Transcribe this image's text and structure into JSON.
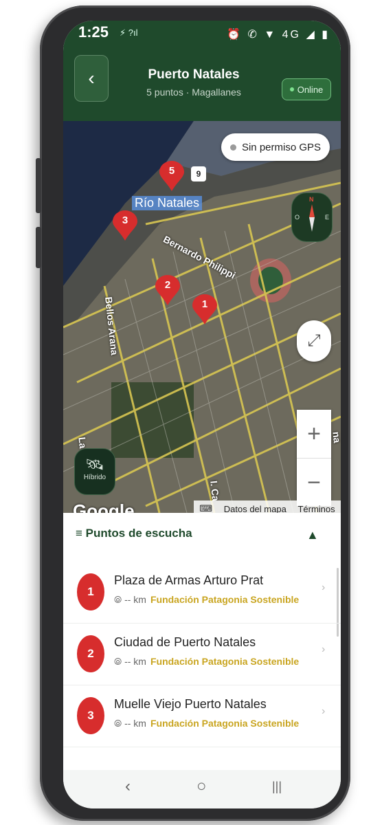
{
  "status": {
    "time": "1:25",
    "left_icons": "⚡ ?ıl",
    "right_icons": "⏰ ✆ ▼ 4G ◢ ▮"
  },
  "header": {
    "title": "Puerto Natales",
    "subtitle": "5 puntos · Magallanes",
    "back_icon": "‹",
    "online_label": "Online"
  },
  "map": {
    "gps_label": "Sin permiso GPS",
    "route_number": "9",
    "river_label": "Río Natales",
    "streets": [
      "Bernardo Philippi",
      "Bellos Arana",
      "La",
      "I. Ca",
      "na"
    ],
    "compass": {
      "n": "N",
      "o": "O",
      "e": "E"
    },
    "fullscreen_icon": "⤢",
    "zoom_in": "+",
    "zoom_out": "−",
    "hybrid_label": "Híbrido",
    "google_logo": "Google",
    "attribution": {
      "keyboard_icon": "⌨",
      "data": "Datos del mapa",
      "terms": "Términos"
    },
    "pins": [
      "5",
      "3",
      "2",
      "1"
    ]
  },
  "sheet": {
    "title": "≡ Puntos de escucha",
    "toggle": "▲",
    "items": [
      {
        "num": "1",
        "name": "Plaza de Armas Arturo Prat",
        "distance": "⦾ -- km",
        "org": "Fundación Patagonia Sostenible"
      },
      {
        "num": "2",
        "name": "Ciudad de Puerto Natales",
        "distance": "⦾ -- km",
        "org": "Fundación Patagonia Sostenible"
      },
      {
        "num": "3",
        "name": "Muelle Viejo Puerto Natales",
        "distance": "⦾ -- km",
        "org": "Fundación Patagonia Sostenible"
      }
    ]
  },
  "nav": {
    "back": "‹",
    "home": "○",
    "recent": "|||"
  },
  "colors": {
    "header_green": "#1f4a2c",
    "pin_red": "#d72d2d",
    "org_gold": "#c9a520"
  }
}
